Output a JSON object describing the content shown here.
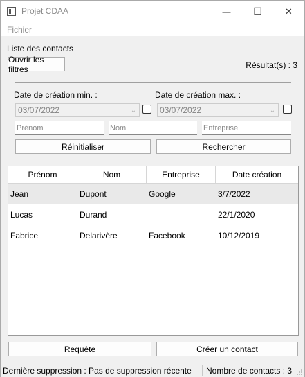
{
  "window": {
    "title": "Projet CDAA",
    "minimize_glyph": "—",
    "maximize_glyph": "☐",
    "close_glyph": "✕"
  },
  "menu": {
    "items": [
      "Fichier"
    ]
  },
  "contacts": {
    "heading": "Liste des contacts",
    "open_filters_label": "Ouvrir les filtres",
    "results_text": "Résultat(s) : 3"
  },
  "filters": {
    "date_min_label": "Date de création min. :",
    "date_max_label": "Date de création max. :",
    "date_min_value": "03/07/2022",
    "date_max_value": "03/07/2022",
    "firstname_placeholder": "Prénom",
    "lastname_placeholder": "Nom",
    "company_placeholder": "Entreprise",
    "reset_label": "Réinitialiser",
    "search_label": "Rechercher"
  },
  "table": {
    "columns": [
      "Prénom",
      "Nom",
      "Entreprise",
      "Date création"
    ],
    "rows": [
      [
        "Jean",
        "Dupont",
        "Google",
        "3/7/2022"
      ],
      [
        "Lucas",
        "Durand",
        "",
        "22/1/2020"
      ],
      [
        "Fabrice",
        "Delarivère",
        "Facebook",
        "10/12/2019"
      ]
    ]
  },
  "actions": {
    "query_label": "Requête",
    "create_contact_label": "Créer un contact"
  },
  "status": {
    "last_deletion": "Dernière suppression : Pas de suppression récente",
    "contact_count": "Nombre de contacts : 3"
  }
}
